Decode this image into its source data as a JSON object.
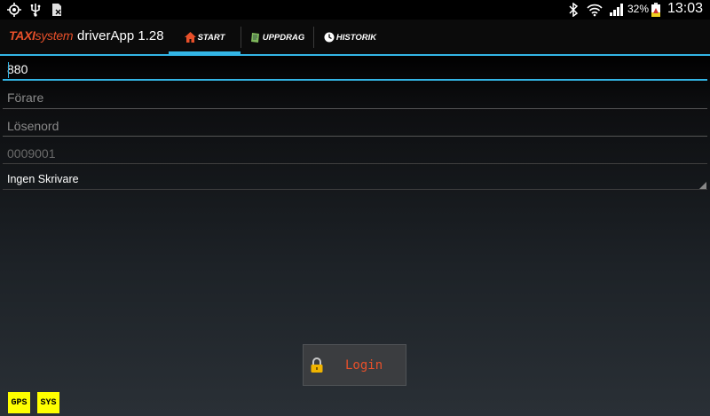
{
  "status_bar": {
    "battery_percent": "32%",
    "time": "13:03",
    "icons": [
      "gps-target-icon",
      "usb-icon",
      "sd-card-icon",
      "bluetooth-icon",
      "wifi-icon",
      "signal-icon",
      "battery-icon"
    ]
  },
  "action_bar": {
    "brand_taxi": "TAXI",
    "brand_system": "system",
    "app_title": "driverApp 1.28",
    "tabs": [
      {
        "label": "START",
        "icon": "home-icon",
        "selected": true
      },
      {
        "label": "UPPDRAG",
        "icon": "clipboard-icon",
        "selected": false
      },
      {
        "label": "HISTORIK",
        "icon": "clock-icon",
        "selected": false
      }
    ],
    "accent_color": "#33b5e5",
    "brand_color": "#e8502a"
  },
  "form": {
    "vehicle_number_value": "880",
    "driver_placeholder": "Förare",
    "password_placeholder": "Lösenord",
    "device_id_value": "0009001",
    "printer_selected": "Ingen Skrivare"
  },
  "login_button": {
    "label": "Login",
    "icon": "lock-icon"
  },
  "indicators": [
    {
      "label": "GPS",
      "color": "#ffff00"
    },
    {
      "label": "SYS",
      "color": "#ffff00"
    }
  ]
}
